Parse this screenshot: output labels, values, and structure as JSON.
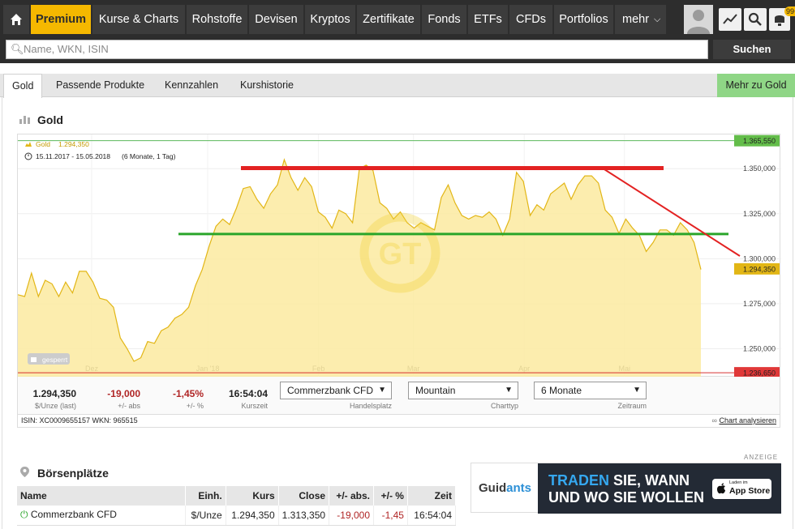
{
  "nav": {
    "items": [
      "Premium",
      "Kurse & Charts",
      "Rohstoffe",
      "Devisen",
      "Kryptos",
      "Zertifikate",
      "Fonds",
      "ETFs",
      "CFDs",
      "Portfolios",
      "mehr"
    ],
    "badge": "99+"
  },
  "search": {
    "placeholder": "Name, WKN, ISIN",
    "button": "Suchen"
  },
  "tabs": [
    "Gold",
    "Passende Produkte",
    "Kennzahlen",
    "Kurshistorie"
  ],
  "tab_right": "Mehr zu Gold",
  "section_title": "Gold",
  "chart_legend": {
    "name": "Gold",
    "value": "1.294,350",
    "range": "15.11.2017 - 15.05.2018",
    "range_note": "(6 Monate, 1 Tag)"
  },
  "watermark": "GT",
  "locked_label": "gesperrt",
  "chart_data": {
    "type": "area",
    "x_labels": [
      "Dez",
      "Jan '18",
      "Feb",
      "Mar",
      "Apr",
      "Mai"
    ],
    "y_ticks": [
      "1.350,000",
      "1.325,000",
      "1.300,000",
      "1.275,000",
      "1.250,000"
    ],
    "y_tick_values": [
      1350,
      1325,
      1300,
      1275,
      1250
    ],
    "ylim": [
      1234,
      1369
    ],
    "series": [
      {
        "values": [
          1280,
          1279,
          1292,
          1279,
          1288,
          1286,
          1279,
          1287,
          1281,
          1293,
          1293,
          1287,
          1278,
          1277,
          1273,
          1256,
          1250,
          1243,
          1245,
          1254,
          1253,
          1260,
          1262,
          1267,
          1269,
          1273,
          1285,
          1294,
          1307,
          1318,
          1322,
          1319,
          1328,
          1339,
          1340,
          1333,
          1328,
          1336,
          1341,
          1355,
          1345,
          1338,
          1345,
          1340,
          1326,
          1323,
          1317,
          1327,
          1325,
          1320,
          1350,
          1352,
          1349,
          1331,
          1328,
          1322,
          1326,
          1320,
          1317,
          1320,
          1318,
          1316,
          1334,
          1341,
          1331,
          1324,
          1322,
          1324,
          1323,
          1326,
          1322,
          1313,
          1322,
          1348,
          1343,
          1324,
          1330,
          1327,
          1336,
          1339,
          1342,
          1333,
          1341,
          1346,
          1346,
          1342,
          1327,
          1323,
          1314,
          1322,
          1317,
          1313,
          1304,
          1309,
          1316,
          1316,
          1313,
          1320,
          1316,
          1309,
          1294
        ]
      }
    ],
    "level_labels": [
      "1.365,550",
      "1.294,350",
      "1.236,650"
    ],
    "level_values": [
      1365.55,
      1294.35,
      1236.65
    ],
    "resistance_level": 1350.3,
    "support_level": 1313.7,
    "trend_from": 1350.5,
    "trend_to": 1301.5
  },
  "quote": {
    "kurs": "1.294,350",
    "kurs_label": "$/Unze (last)",
    "abs": "-19,000",
    "abs_label": "+/- abs",
    "pct": "-1,45%",
    "pct_label": "+/- %",
    "zeit": "16:54:04",
    "zeit_label": "Kurszeit"
  },
  "selects": [
    {
      "value": "Commerzbank CFD",
      "label": "Handelsplatz"
    },
    {
      "value": "Mountain",
      "label": "Charttyp"
    },
    {
      "value": "6 Monate",
      "label": "Zeitraum"
    }
  ],
  "isin_line": "ISIN: XC0009655157 WKN: 965515",
  "analyse_link": "Chart analysieren",
  "ad_label": "ANZEIGE",
  "boersen_title": "Börsenplätze",
  "table": {
    "headers": [
      "Name",
      "Einh.",
      "Kurs",
      "Close",
      "+/- abs.",
      "+/- %",
      "Zeit"
    ],
    "rows": [
      [
        "Commerzbank CFD",
        "$/Unze",
        "1.294,350",
        "1.313,350",
        "-19,000",
        "-1,45",
        "16:54:04"
      ]
    ]
  },
  "ad": {
    "brand_a": "Guid",
    "brand_b": "ants",
    "line1a": "TRADEN",
    "line1b": "SIE, WANN",
    "line2": "UND WO SIE WOLLEN",
    "store_top": "Laden im",
    "store": "App Store"
  },
  "colors": {
    "accent": "#f5b800",
    "gold": "#e8b800",
    "red": "#e32222",
    "green": "#2aa52a",
    "neg": "#b02525"
  }
}
